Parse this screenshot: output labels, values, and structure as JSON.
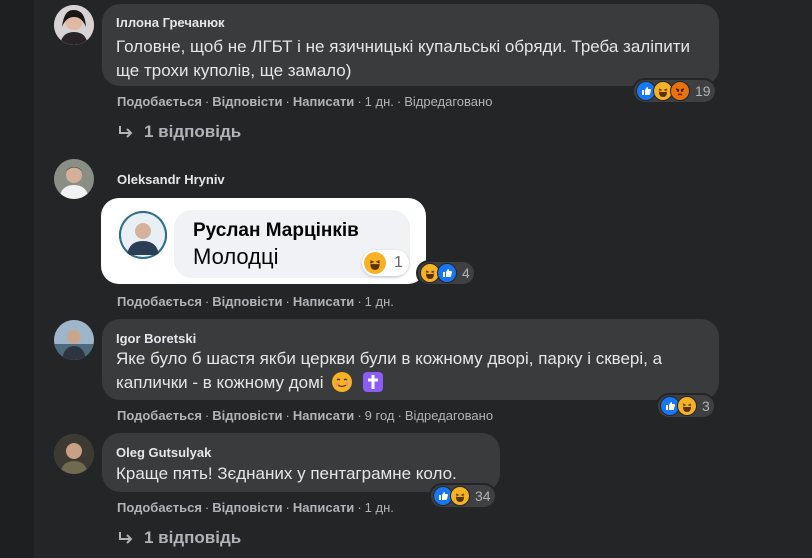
{
  "comments": [
    {
      "author": "Іллона Гречанюк",
      "text": "Головне, щоб не ЛГБТ і не язичницькі купальські обряди. Треба заліпити ще трохи куполів, ще замало)",
      "actions": {
        "like": "Подобається",
        "reply": "Відповісти",
        "write": "Написати",
        "time": "1 дн.",
        "edited": "Відредаговано"
      },
      "reactions": {
        "icons": [
          "like-icon",
          "haha-icon",
          "angry-icon"
        ],
        "count": "19"
      },
      "replies_label": "1 відповідь"
    },
    {
      "author": "Oleksandr Hryniv",
      "shared_comment": {
        "author": "Руслан Марцінків",
        "text": "Молодці",
        "reactions": {
          "icons": [
            "haha-icon"
          ],
          "count": "1"
        }
      },
      "actions": {
        "like": "Подобається",
        "reply": "Відповісти",
        "write": "Написати",
        "time": "1 дн."
      },
      "reactions": {
        "icons": [
          "haha-icon",
          "like-icon"
        ],
        "count": "4"
      }
    },
    {
      "author": "Igor Boretski",
      "text": "Яке було б шастя якби церкви були в кожному дворі, парку і скверi, а каплички - в кожному домі",
      "actions": {
        "like": "Подобається",
        "reply": "Відповісти",
        "write": "Написати",
        "time": "9 год",
        "edited": "Відредаговано"
      },
      "reactions": {
        "icons": [
          "like-icon",
          "haha-icon"
        ],
        "count": "3"
      }
    },
    {
      "author": "Oleg Gutsulyak",
      "text": "Краще пять! Зєднаних у пентаграмне коло.",
      "actions": {
        "like": "Подобається",
        "reply": "Відповісти",
        "write": "Написати",
        "time": "1 дн."
      },
      "reactions": {
        "icons": [
          "like-icon",
          "haha-icon"
        ],
        "count": "34"
      },
      "replies_label": "1 відповідь"
    }
  ],
  "colors": {
    "background": "#242526",
    "bubble": "#3a3b3c",
    "text": "#e4e6eb",
    "secondary": "#b0b3b8",
    "like_blue": "#1877f2",
    "haha_yellow": "#f7b125",
    "angry_orange": "#e9710f",
    "cross_purple": "#8b5cf6"
  }
}
